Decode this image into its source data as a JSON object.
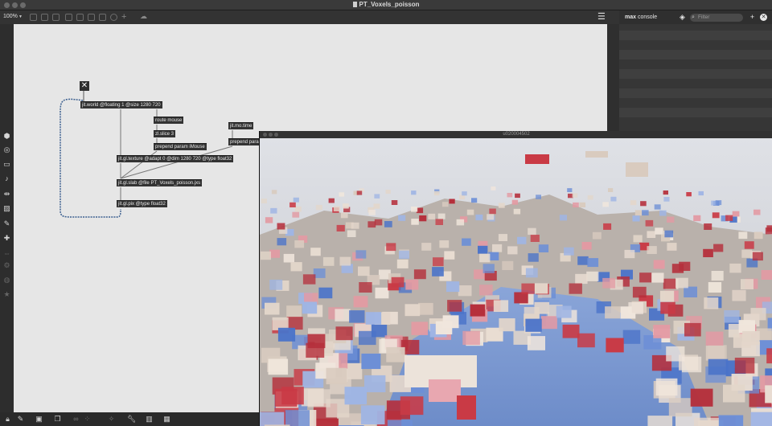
{
  "window": {
    "title": "PT_Voxels_poisson"
  },
  "toolbar": {
    "zoom": "100%"
  },
  "console": {
    "title_bold": "max",
    "title": "console",
    "filter_placeholder": "Filter"
  },
  "patcher": {
    "objects": [
      {
        "id": "jit-world",
        "text": "jit.world @floating 1 @size 1280 720"
      },
      {
        "id": "route-mouse",
        "text": "route mouse"
      },
      {
        "id": "zl-slice",
        "text": "zl.slice 3"
      },
      {
        "id": "prepend-imouse",
        "text": "prepend param iMouse"
      },
      {
        "id": "jit-mo-time",
        "text": "jit.mo.time"
      },
      {
        "id": "prepend-param",
        "text": "prepend para"
      },
      {
        "id": "jit-gl-texture",
        "text": "jit.gl.texture @adapt 0 @dim 1280 720 @type float32"
      },
      {
        "id": "jit-gl-slab",
        "text": "jit.gl.slab @file PT_Voxels_poisson.jxs"
      },
      {
        "id": "jit-gl-pix",
        "text": "jit.gl.pix @type float32"
      }
    ],
    "toggle_icon": "x-toggle-icon"
  },
  "viewer": {
    "title": "u020004502"
  },
  "colors": {
    "accent_red": "#c4303a",
    "accent_blue": "#3f6fc9",
    "patcher_bg": "#e6e6e6",
    "object_bg": "#333333"
  }
}
